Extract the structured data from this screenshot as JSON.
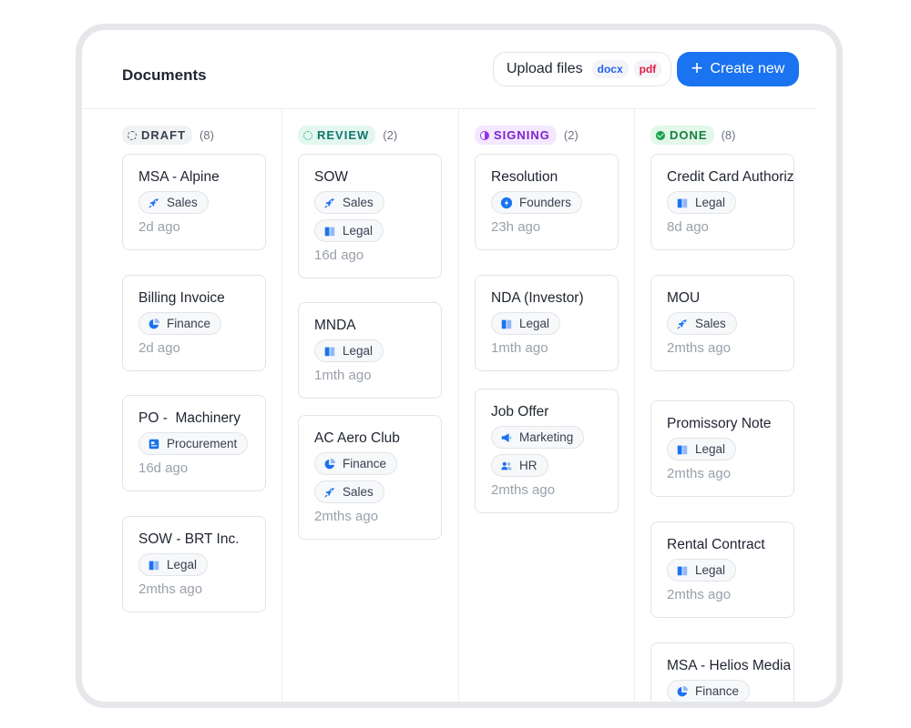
{
  "header": {
    "title": "Documents",
    "upload_label": "Upload files",
    "formats": [
      "docx",
      "pdf"
    ],
    "create_label": "Create new"
  },
  "columns": [
    {
      "status": "DRAFT",
      "count": "(8)",
      "cards": [
        {
          "name": "MSA - Alpine",
          "tags": [
            {
              "label": "Sales",
              "icon": "rocket-icon"
            }
          ],
          "time": "2d ago"
        },
        {
          "name": "Billing Invoice",
          "tags": [
            {
              "label": "Finance",
              "icon": "pie-chart-icon"
            }
          ],
          "time": "2d ago"
        },
        {
          "name": "PO -  Machinery",
          "tags": [
            {
              "label": "Procurement",
              "icon": "receipt-icon"
            }
          ],
          "time": "16d ago"
        },
        {
          "name": "SOW - BRT Inc.",
          "tags": [
            {
              "label": "Legal",
              "icon": "book-icon"
            }
          ],
          "time": "2mths ago"
        }
      ]
    },
    {
      "status": "REVIEW",
      "count": "(2)",
      "cards": [
        {
          "name": "SOW",
          "tags": [
            {
              "label": "Sales",
              "icon": "rocket-icon"
            },
            {
              "label": "Legal",
              "icon": "book-icon"
            }
          ],
          "time": "16d ago"
        },
        {
          "name": "MNDA",
          "tags": [
            {
              "label": "Legal",
              "icon": "book-icon"
            }
          ],
          "time": "1mth ago"
        },
        {
          "name": "AC Aero Club",
          "tags": [
            {
              "label": "Finance",
              "icon": "pie-chart-icon"
            },
            {
              "label": "Sales",
              "icon": "rocket-icon"
            }
          ],
          "time": "2mths ago"
        }
      ]
    },
    {
      "status": "SIGNING",
      "count": "(2)",
      "cards": [
        {
          "name": "Resolution",
          "tags": [
            {
              "label": "Founders",
              "icon": "bolt-icon"
            }
          ],
          "time": "23h ago"
        },
        {
          "name": "NDA (Investor)",
          "tags": [
            {
              "label": "Legal",
              "icon": "book-icon"
            }
          ],
          "time": "1mth ago"
        },
        {
          "name": "Job Offer",
          "tags": [
            {
              "label": "Marketing",
              "icon": "megaphone-icon"
            },
            {
              "label": "HR",
              "icon": "users-icon"
            }
          ],
          "time": "2mths ago"
        }
      ]
    },
    {
      "status": "DONE",
      "count": "(8)",
      "cards": [
        {
          "name": "Credit Card Authorization",
          "tags": [
            {
              "label": "Legal",
              "icon": "book-icon"
            }
          ],
          "time": "8d ago"
        },
        {
          "name": "MOU",
          "tags": [
            {
              "label": "Sales",
              "icon": "rocket-icon"
            }
          ],
          "time": "2mths ago"
        },
        {
          "name": "Promissory Note",
          "tags": [
            {
              "label": "Legal",
              "icon": "book-icon"
            }
          ],
          "time": "2mths ago"
        },
        {
          "name": "Rental Contract",
          "tags": [
            {
              "label": "Legal",
              "icon": "book-icon"
            }
          ],
          "time": "2mths ago"
        },
        {
          "name": "MSA - Helios Media",
          "tags": [
            {
              "label": "Finance",
              "icon": "pie-chart-icon"
            }
          ],
          "time": ""
        }
      ]
    }
  ]
}
